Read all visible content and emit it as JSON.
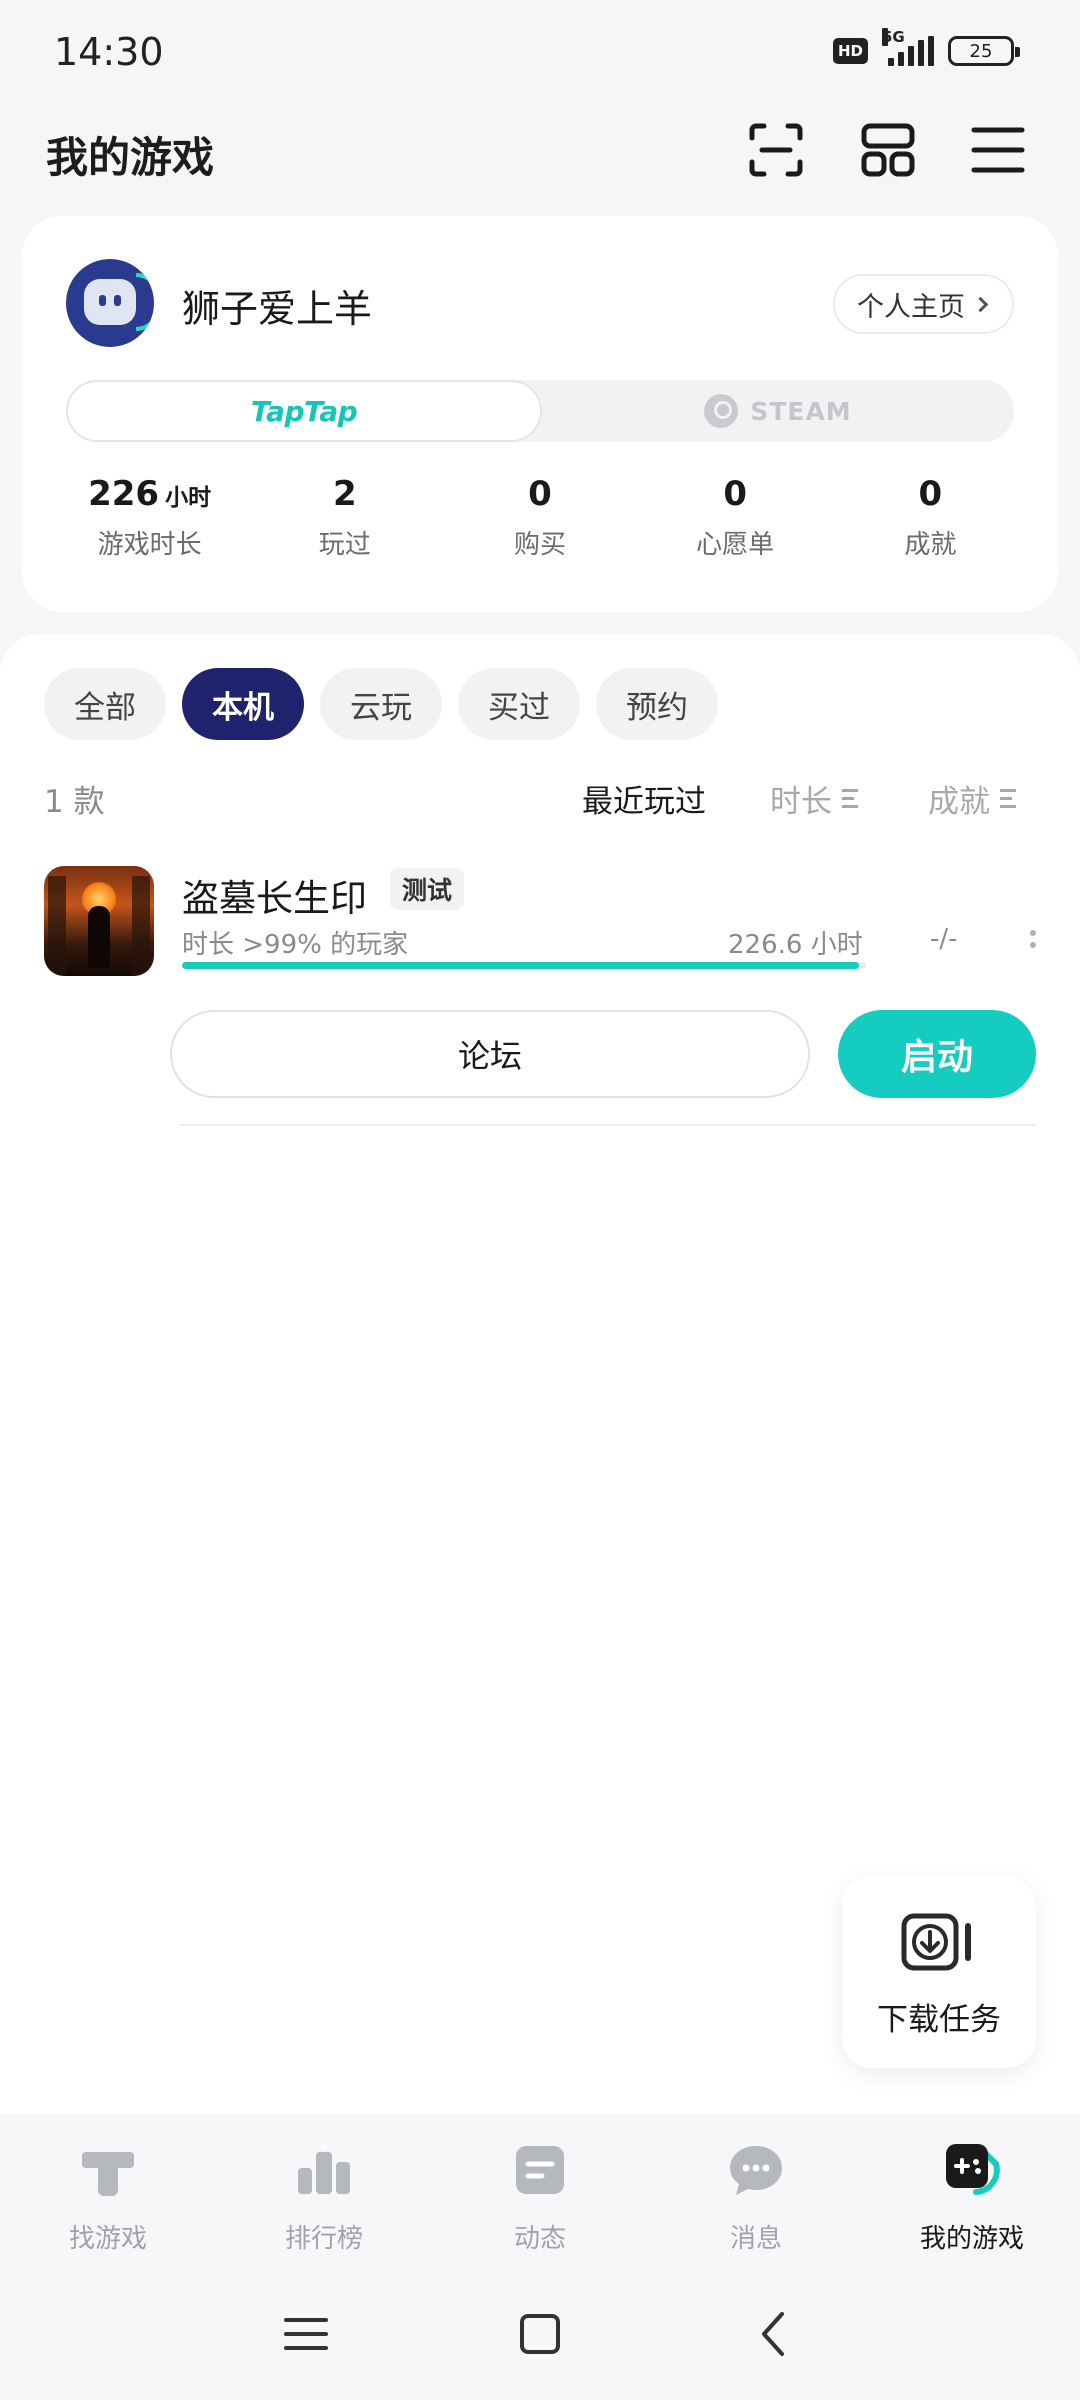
{
  "status_bar": {
    "time": "14:30",
    "hd": "HD",
    "network": "5G",
    "battery": "25"
  },
  "header": {
    "title": "我的游戏"
  },
  "profile": {
    "username": "狮子爱上羊",
    "home_button": "个人主页",
    "platforms": [
      "TapTap",
      "STEAM"
    ],
    "stats": [
      {
        "value": "226",
        "unit": "小时",
        "label": "游戏时长"
      },
      {
        "value": "2",
        "unit": "",
        "label": "玩过"
      },
      {
        "value": "0",
        "unit": "",
        "label": "购买"
      },
      {
        "value": "0",
        "unit": "",
        "label": "心愿单"
      },
      {
        "value": "0",
        "unit": "",
        "label": "成就"
      }
    ]
  },
  "filters": [
    "全部",
    "本机",
    "云玩",
    "买过",
    "预约"
  ],
  "active_filter": "本机",
  "list": {
    "count": "1 款",
    "sort_options": [
      "最近玩过",
      "时长",
      "成就"
    ]
  },
  "game": {
    "name": "盗墓长生印",
    "badge": "测试",
    "playtime_rank": "时长 >99% 的玩家",
    "hours": "226.6 小时",
    "progress_fraction": 0.99,
    "achievements": "-/-",
    "forum_label": "论坛",
    "launch_label": "启动"
  },
  "download_task": {
    "label": "下载任务"
  },
  "bottom_nav": [
    {
      "label": "找游戏",
      "icon": "find-games-icon"
    },
    {
      "label": "排行榜",
      "icon": "leaderboard-icon"
    },
    {
      "label": "动态",
      "icon": "feed-icon"
    },
    {
      "label": "消息",
      "icon": "message-icon"
    },
    {
      "label": "我的游戏",
      "icon": "my-games-icon"
    }
  ],
  "colors": {
    "accent": "#14ccbf",
    "active_chip": "#1f236e",
    "brand_taptap": "#15c5b8"
  }
}
